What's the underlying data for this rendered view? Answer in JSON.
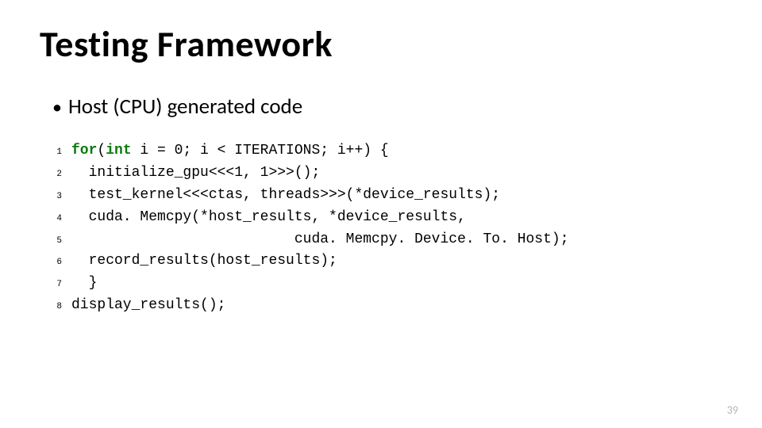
{
  "title": "Testing Framework",
  "bullet": "Host (CPU) generated code",
  "page_number": "39",
  "code": {
    "lines": [
      {
        "n": "1",
        "segments": [
          {
            "cls": "kw",
            "t": "for"
          },
          {
            "cls": "",
            "t": "("
          },
          {
            "cls": "type",
            "t": "int"
          },
          {
            "cls": "",
            "t": " i = 0; i < ITERATIONS; i++) {"
          }
        ]
      },
      {
        "n": "2",
        "segments": [
          {
            "cls": "",
            "t": "  initialize_gpu<<<1, 1>>>();"
          }
        ]
      },
      {
        "n": "3",
        "segments": [
          {
            "cls": "",
            "t": "  test_kernel<<<ctas, threads>>>(*device_results);"
          }
        ]
      },
      {
        "n": "4",
        "segments": [
          {
            "cls": "",
            "t": "  cuda. Memcpy(*host_results, *device_results,"
          }
        ]
      },
      {
        "n": "5",
        "segments": [
          {
            "cls": "",
            "t": "                          cuda. Memcpy. Device. To. Host);"
          }
        ]
      },
      {
        "n": "6",
        "segments": [
          {
            "cls": "",
            "t": "  record_results(host_results);"
          }
        ]
      },
      {
        "n": "7",
        "segments": [
          {
            "cls": "",
            "t": "  }"
          }
        ]
      },
      {
        "n": "8",
        "segments": [
          {
            "cls": "",
            "t": "display_results();"
          }
        ]
      }
    ]
  }
}
